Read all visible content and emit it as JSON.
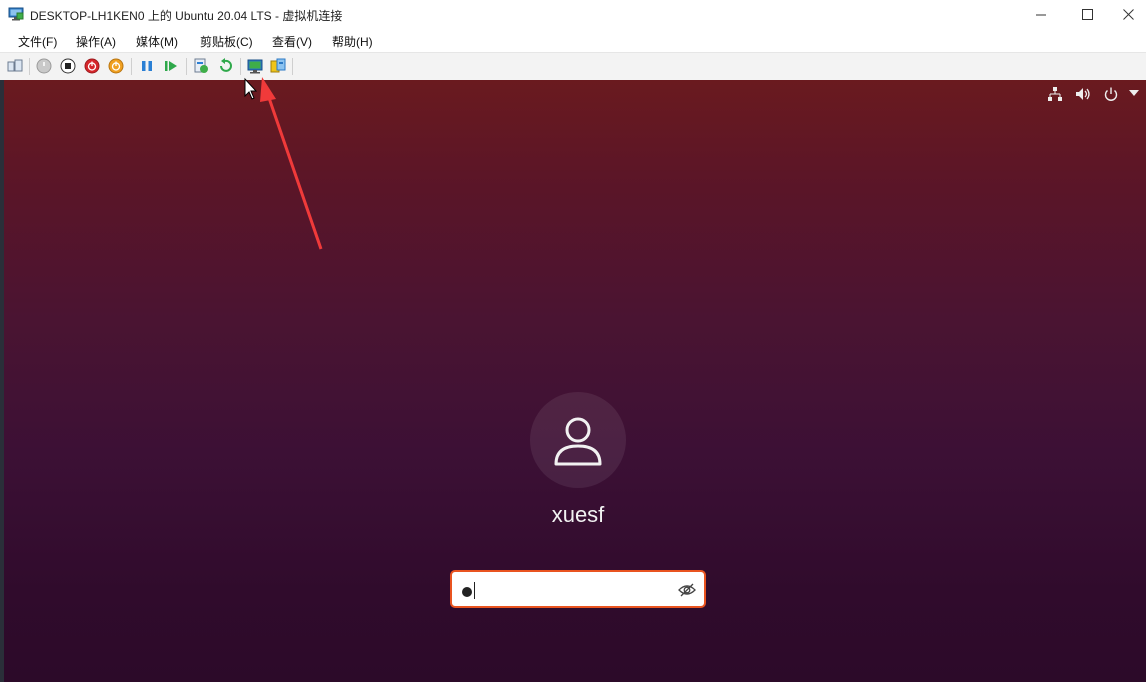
{
  "window": {
    "title": "DESKTOP-LH1KEN0 上的 Ubuntu 20.04 LTS - 虚拟机连接",
    "minimize_icon": "minimize-icon",
    "maximize_icon": "maximize-icon",
    "close_icon": "close-icon"
  },
  "menu": {
    "items": [
      {
        "label": "文件(F)"
      },
      {
        "label": "操作(A)"
      },
      {
        "label": "媒体(M)"
      },
      {
        "label": "剪贴板(C)"
      },
      {
        "label": "查看(V)"
      },
      {
        "label": "帮助(H)"
      }
    ]
  },
  "toolbar": {
    "icons": [
      "ctrl-alt-del-icon",
      "start-icon",
      "turn-off-icon",
      "shutdown-icon",
      "save-state-icon",
      "pause-icon",
      "resume-icon",
      "checkpoint-icon",
      "revert-icon",
      "enhanced-session-icon",
      "share-icon"
    ]
  },
  "vm": {
    "top_bar_icons": [
      "network-icon",
      "volume-icon",
      "power-icon",
      "dropdown-arrow-icon"
    ],
    "login": {
      "username": "xuesf",
      "password_masked": "●"
    }
  },
  "colors": {
    "accent": "#e95420",
    "annotation_arrow": "#f03a3a"
  }
}
